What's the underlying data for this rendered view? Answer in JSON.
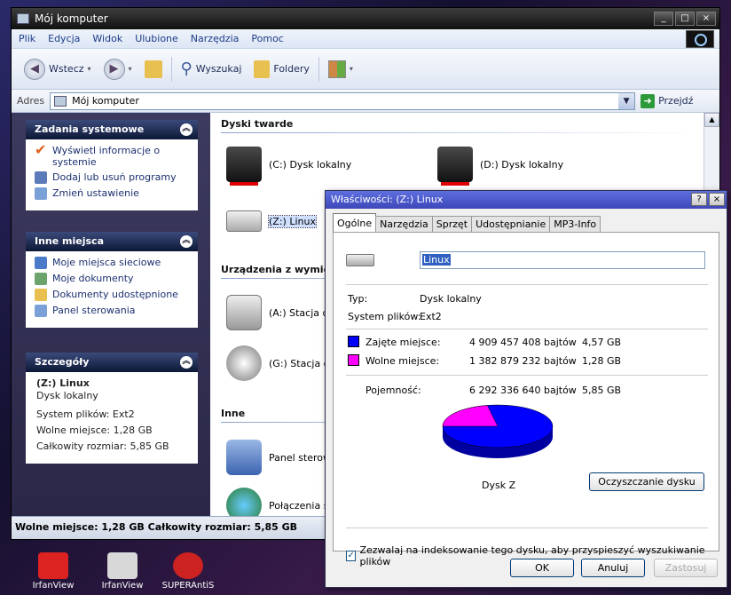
{
  "desktop": {
    "icons": [
      {
        "label": "IrfanView",
        "color": "#d22"
      },
      {
        "label": "IrfanView",
        "color": "#d8d8d8"
      },
      {
        "label": "SUPERAntiS",
        "color": "#c22"
      }
    ]
  },
  "explorer": {
    "title": "Mój komputer",
    "menu": [
      "Plik",
      "Edycja",
      "Widok",
      "Ulubione",
      "Narzędzia",
      "Pomoc"
    ],
    "toolbar": {
      "back": "Wstecz",
      "search": "Wyszukaj",
      "folders": "Foldery"
    },
    "address": {
      "label": "Adres",
      "value": "Mój komputer",
      "go": "Przejdź"
    },
    "tasks": {
      "title": "Zadania systemowe",
      "items": [
        "Wyświetl informacje o systemie",
        "Dodaj lub usuń programy",
        "Zmień ustawienie"
      ]
    },
    "places": {
      "title": "Inne miejsca",
      "items": [
        "Moje miejsca sieciowe",
        "Moje dokumenty",
        "Dokumenty udostępnione",
        "Panel sterowania"
      ]
    },
    "details": {
      "title": "Szczegóły",
      "name": "(Z:) Linux",
      "type": "Dysk lokalny",
      "fs": "System plików: Ext2",
      "free": "Wolne miejsce: 1,28 GB",
      "total": "Całkowity rozmiar: 5,85 GB"
    },
    "sections": {
      "hard": "Dyski twarde",
      "removable": "Urządzenia z wymier",
      "other": "Inne"
    },
    "items": {
      "c": "(C:) Dysk lokalny",
      "d": "(D:) Dysk lokalny",
      "z": "(Z:) Linux",
      "a": "(A:) Stacja d",
      "g": "(G:) Stacja d",
      "panel": "Panel sterow",
      "conn": "Połączenia s"
    },
    "status": "Wolne miejsce: 1,28 GB Całkowity rozmiar: 5,85 GB"
  },
  "dialog": {
    "title": "Właściwości: (Z:) Linux",
    "tabs": [
      "Ogólne",
      "Narzędzia",
      "Sprzęt",
      "Udostępnianie",
      "MP3-Info"
    ],
    "name_value": "Linux",
    "type_label": "Typ:",
    "type_value": "Dysk lokalny",
    "fs_label": "System plików:",
    "fs_value": "Ext2",
    "used": {
      "label": "Zajęte miejsce:",
      "bytes": "4 909 457 408 bajtów",
      "gb": "4,57 GB",
      "color": "#0000ff"
    },
    "free": {
      "label": "Wolne miejsce:",
      "bytes": "1 382 879 232 bajtów",
      "gb": "1,28 GB",
      "color": "#ff00ff"
    },
    "capacity": {
      "label": "Pojemność:",
      "bytes": "6 292 336 640 bajtów",
      "gb": "5,85 GB"
    },
    "used_fraction": 0.7802,
    "disk_label": "Dysk Z",
    "cleanup": "Oczyszczanie dysku",
    "index_checkbox": "Zezwalaj na indeksowanie tego dysku, aby przyspieszyć wyszukiwanie plików",
    "index_checked": true,
    "ok": "OK",
    "cancel": "Anuluj",
    "apply": "Zastosuj"
  }
}
